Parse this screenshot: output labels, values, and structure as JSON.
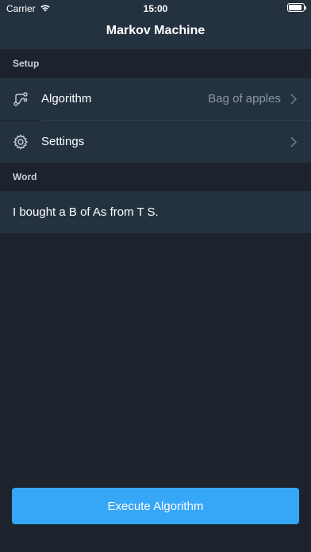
{
  "status_bar": {
    "carrier": "Carrier",
    "time": "15:00"
  },
  "nav": {
    "title": "Markov Machine"
  },
  "sections": {
    "setup": "Setup",
    "word": "Word"
  },
  "setup_rows": [
    {
      "label": "Algorithm",
      "value": "Bag of apples",
      "icon": "algorithm-path-icon"
    },
    {
      "label": "Settings",
      "value": "",
      "icon": "gear-icon"
    }
  ],
  "word": {
    "value": "I bought a B of As from T S."
  },
  "execute": {
    "label": "Execute Algorithm"
  },
  "colors": {
    "background": "#1c232c",
    "cell": "#243240",
    "accent": "#36a6f7",
    "secondary_text": "#8a96a3"
  }
}
